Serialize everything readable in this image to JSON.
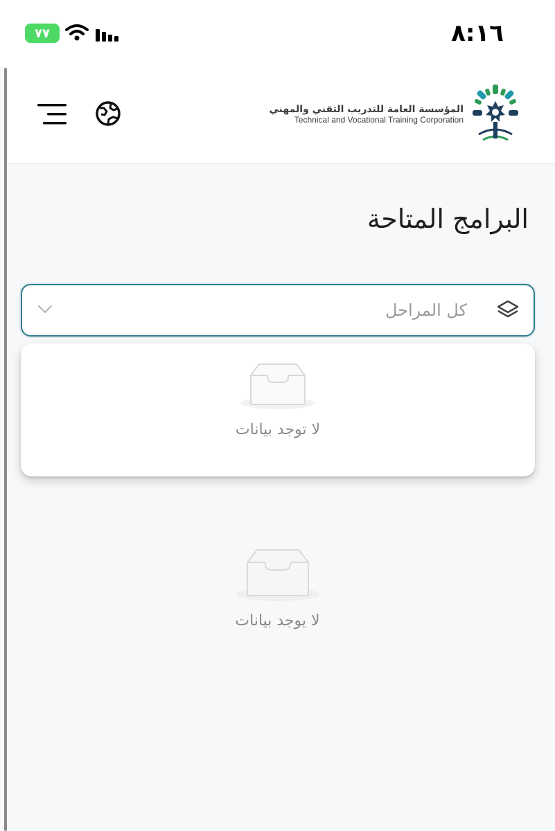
{
  "status_bar": {
    "time": "٨:١٦",
    "battery": "٧٧"
  },
  "header": {
    "logo_ar": "المؤسسة العامة للتدريب التقني والمهني",
    "logo_en": "Technical and Vocational Training Corporation",
    "menu_icon": "hamburger-menu-icon",
    "language_icon": "globe-icon"
  },
  "page": {
    "title": "البرامج المتاحة"
  },
  "stage_select": {
    "placeholder": "كل المراحل",
    "icon": "layers-icon",
    "chevron": "chevron-down-icon"
  },
  "dropdown": {
    "empty_text": "لا توجد بيانات"
  },
  "content": {
    "empty_text": "لا يوجد بيانات"
  },
  "colors": {
    "accent": "#2f7f8f",
    "battery": "#4cd964",
    "logo_teal": "#1f9aa8",
    "logo_green": "#2e9b56",
    "logo_navy": "#1f3f5e"
  }
}
